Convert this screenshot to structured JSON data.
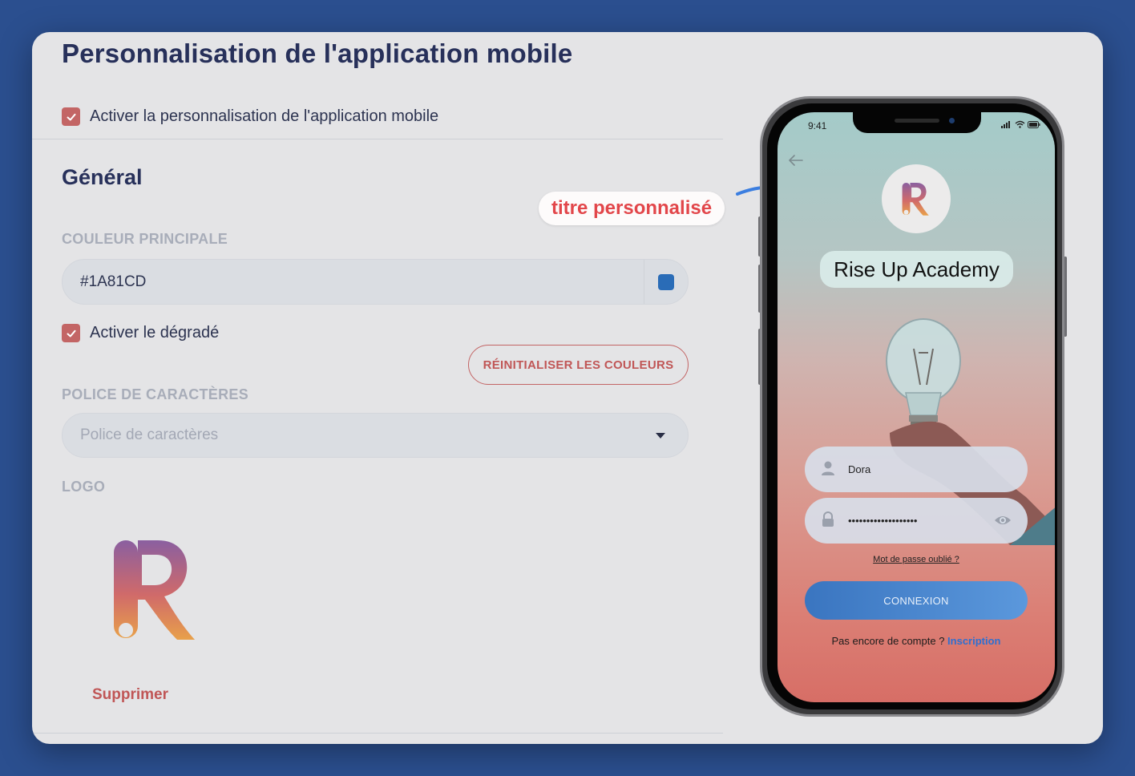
{
  "page": {
    "title": "Personnalisation de l'application mobile",
    "enable_custom_label": "Activer la personnalisation de l'application mobile",
    "enable_custom_checked": true
  },
  "general": {
    "section_title": "Général",
    "main_color_label": "COULEUR PRINCIPALE",
    "main_color_value": "#1A81CD",
    "main_color_swatch": "#2a6cb7",
    "gradient_label": "Activer le dégradé",
    "gradient_checked": true,
    "reset_button": "RÉINITIALISER LES COULEURS",
    "font_label": "POLICE DE CARACTÈRES",
    "font_placeholder": "Police de caractères",
    "logo_label": "LOGO",
    "delete_label": "Supprimer"
  },
  "annotation": {
    "text": "titre personnalisé"
  },
  "phone": {
    "time": "9:41",
    "app_title": "Rise Up Academy",
    "username": "Dora",
    "password": "•••••••••••••••••••",
    "forgot": "Mot de passe oublié ?",
    "login_button": "CONNEXION",
    "no_account": "Pas encore de compte ? ",
    "signup": "Inscription"
  },
  "colors": {
    "accent": "#c36565",
    "title": "#27305a",
    "background": "#2b4f8f",
    "primary_button": "#3a75c0"
  }
}
